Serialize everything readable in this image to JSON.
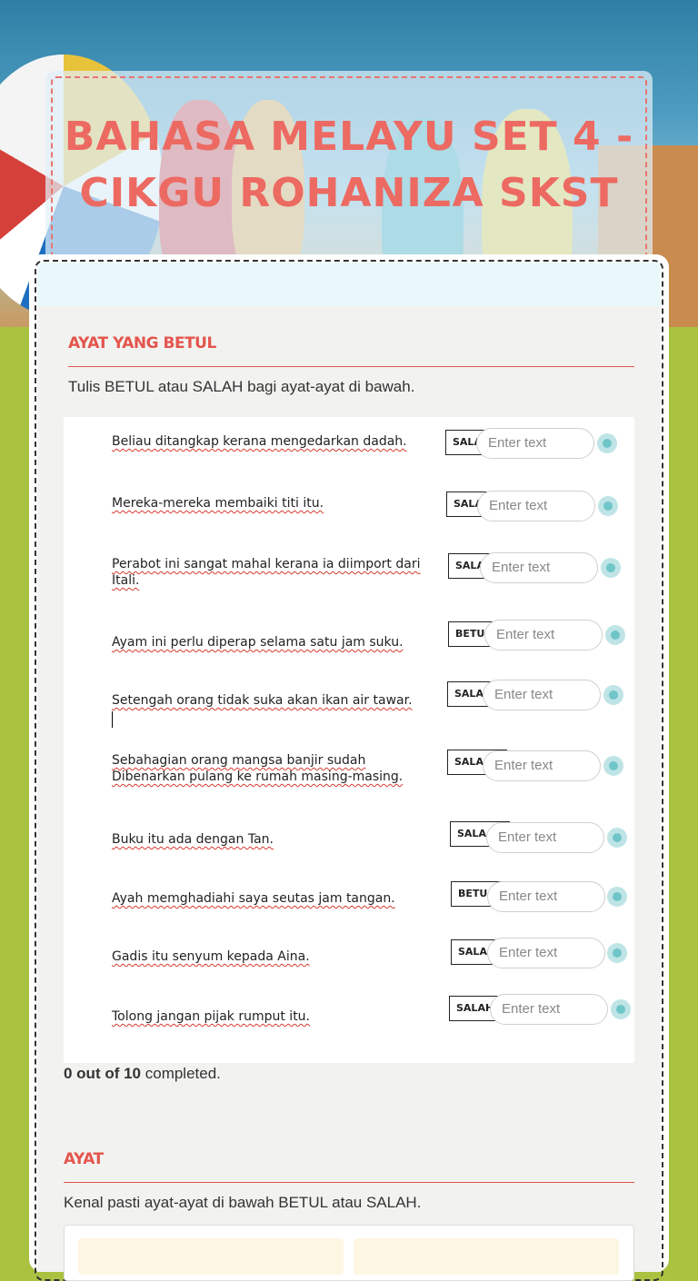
{
  "title": "BAHASA MELAYU SET 4 - CIKGU ROHANIZA SKST",
  "section1": {
    "heading": "AYAT YANG BETUL",
    "instruction": "Tulis BETUL atau SALAH bagi ayat-ayat di bawah.",
    "placeholder": "Enter text",
    "questions": [
      {
        "text": "Beliau ditangkap kerana mengedarkan dadah.",
        "box": "SALA"
      },
      {
        "text": "Mereka-mereka membaiki titi itu.",
        "box": "SALA"
      },
      {
        "text": "Perabot ini sangat mahal kerana ia diimport dari Itali.",
        "box": "SALA"
      },
      {
        "text": "Ayam ini perlu diperap selama satu jam suku.",
        "box": "BETU"
      },
      {
        "text": "Setengah orang tidak suka akan ikan air tawar.",
        "box": "SALA"
      },
      {
        "text": "Sebahagian orang mangsa banjir sudah Dibenarkan pulang ke rumah masing-masing.",
        "box": "SALA"
      },
      {
        "text": "Buku itu ada dengan Tan.",
        "box": "SALA"
      },
      {
        "text": "Ayah memghadiahi saya seutas jam tangan.",
        "box": "BETU"
      },
      {
        "text": "Gadis itu senyum kepada Aina.",
        "box": "SALA"
      },
      {
        "text": "Tolong jangan pijak rumput itu.",
        "box": "SALAH"
      }
    ],
    "progress_count": "0 out of 10",
    "progress_suffix": " completed."
  },
  "section2": {
    "heading": "AYAT",
    "instruction": "Kenal pasti ayat-ayat di bawah BETUL atau SALAH."
  },
  "colors": {
    "accent": "#e4554d",
    "radio": "#6fc5c8",
    "grass": "#a9c341"
  }
}
